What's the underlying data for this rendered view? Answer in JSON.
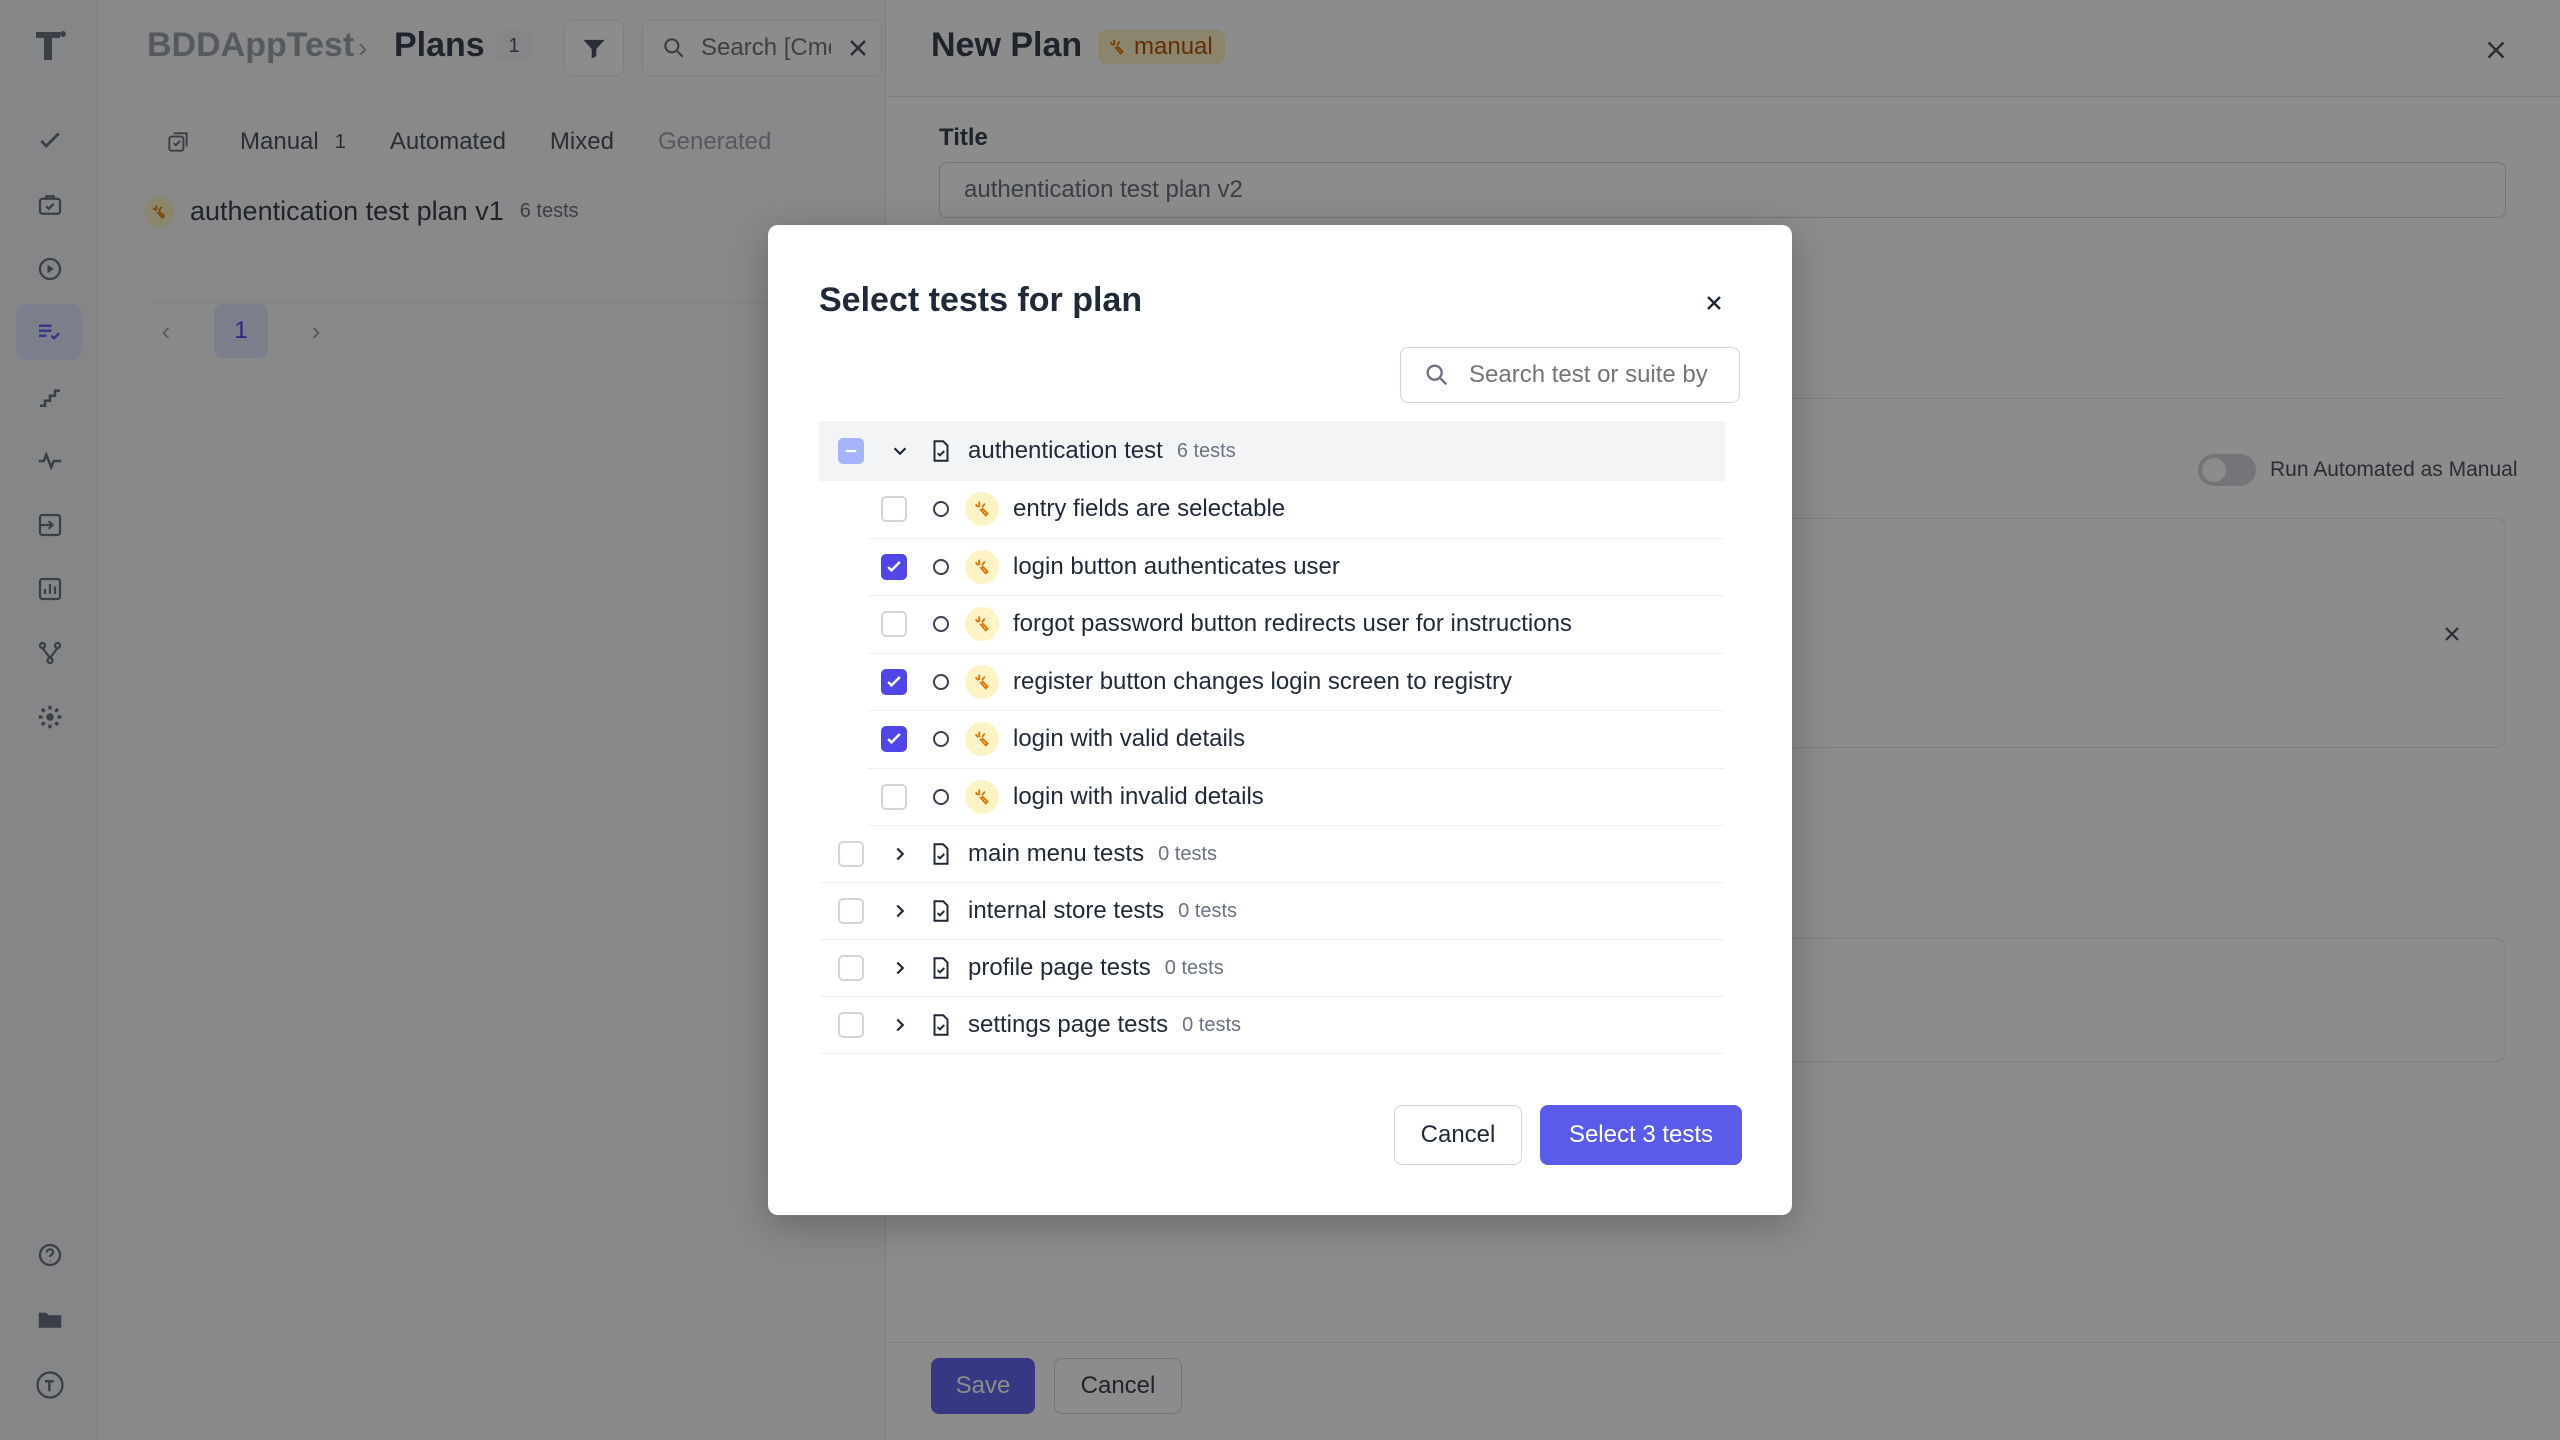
{
  "app": {
    "project": "BDDAppTest",
    "breadcrumb_separator": "›",
    "page": "Plans",
    "page_count": "1"
  },
  "list_panel": {
    "search_placeholder": "Search [Cmd+K]",
    "tabs": [
      {
        "label": "Manual",
        "count": "1"
      },
      {
        "label": "Automated",
        "count": ""
      },
      {
        "label": "Mixed",
        "count": ""
      },
      {
        "label": "Generated",
        "count": ""
      }
    ],
    "plans": [
      {
        "name": "authentication test plan v1",
        "meta": "6 tests"
      }
    ],
    "pager": {
      "current": "1"
    }
  },
  "plan_panel": {
    "title": "New Plan",
    "badge": "manual",
    "title_label": "Title",
    "title_value": "authentication test plan v2",
    "run_automated_label": "Run Automated as Manual",
    "save_label": "Save",
    "cancel_label": "Cancel"
  },
  "modal": {
    "title": "Select tests for plan",
    "search_placeholder": "Search test or suite by name",
    "suites": [
      {
        "name": "authentication test",
        "count": "6 tests",
        "expanded": true,
        "state": "partial",
        "tests": [
          {
            "name": "entry fields are selectable",
            "checked": false
          },
          {
            "name": "login button authenticates user",
            "checked": true
          },
          {
            "name": "forgot password button redirects user for instructions",
            "checked": false
          },
          {
            "name": "register button changes login screen to registry",
            "checked": true
          },
          {
            "name": "login with valid details",
            "checked": true
          },
          {
            "name": "login with invalid details",
            "checked": false
          }
        ]
      },
      {
        "name": "main menu tests",
        "count": "0 tests",
        "expanded": false,
        "state": "unchecked"
      },
      {
        "name": "internal store tests",
        "count": "0 tests",
        "expanded": false,
        "state": "unchecked"
      },
      {
        "name": "profile page tests",
        "count": "0 tests",
        "expanded": false,
        "state": "unchecked"
      },
      {
        "name": "settings page tests",
        "count": "0 tests",
        "expanded": false,
        "state": "unchecked"
      }
    ],
    "cancel_label": "Cancel",
    "select_label": "Select 3 tests"
  },
  "colors": {
    "accent": "#5b5bea",
    "checkbox_checked": "#4f46e5",
    "manual_badge_bg": "#fef3c7",
    "manual_badge_text": "#b45309"
  },
  "icons": {
    "rail": [
      "check-icon",
      "briefcase-check-icon",
      "play-circle-icon",
      "list-check-icon",
      "stairs-icon",
      "pulse-icon",
      "import-icon",
      "chart-icon",
      "branch-icon",
      "gear-icon",
      "help-icon",
      "folder-icon",
      "user-logo-icon"
    ],
    "manual": "hand-sparkle-icon",
    "suite": "file-check-icon"
  }
}
